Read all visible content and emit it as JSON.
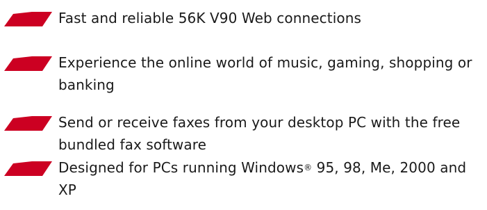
{
  "bullet_color": "#cc0022",
  "bullet_icon": "red-parallelogram-bullet-icon",
  "features": [
    {
      "text": "Fast and reliable 56K V90 Web connections"
    },
    {
      "text": "Experience the online world of music, gaming, shopping or banking"
    },
    {
      "text": "Send or receive faxes from your desktop PC with the free bundled fax software"
    },
    {
      "text_before": "Designed for PCs running Windows",
      "registered_mark": "®",
      "text_after": " 95, 98, Me, 2000 and XP"
    }
  ]
}
